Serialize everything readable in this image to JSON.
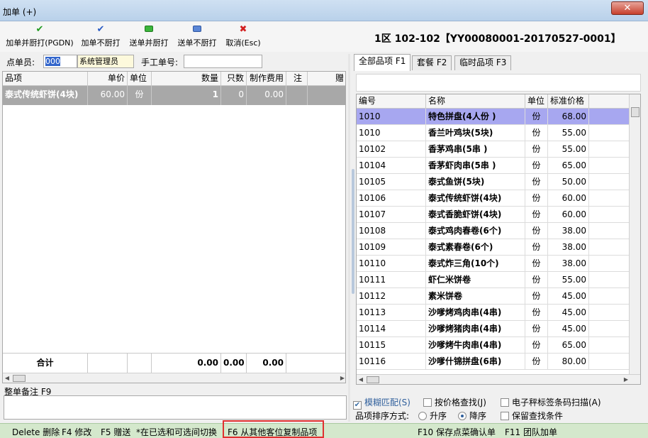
{
  "window": {
    "title": "加单 (+)",
    "close_label": "✕"
  },
  "toolbar": {
    "buttons": [
      {
        "label": "加单并厨打(PGDN)",
        "icon": "check-green-icon",
        "color": "#1f9a1f"
      },
      {
        "label": "加单不厨打",
        "icon": "check-blue-icon",
        "color": "#2a5bc4"
      },
      {
        "label": "送单并厨打",
        "icon": "green-square-icon",
        "color": "#3bb53b"
      },
      {
        "label": "送单不厨打",
        "icon": "blue-square-icon",
        "color": "#5a86d6"
      },
      {
        "label": "取消(Esc)",
        "icon": "cross-red-icon",
        "color": "#d22020"
      }
    ]
  },
  "header": {
    "title": "1区 102-102【YY00080001-20170527-0001】"
  },
  "order": {
    "waiter_label": "点单员:",
    "waiter_code": "000",
    "waiter_name": "系统管理员",
    "manual_no_label": "手工单号:",
    "manual_no_value": ""
  },
  "order_table": {
    "columns": [
      "品项",
      "单价",
      "单位",
      "数量",
      "只数",
      "制作费用",
      "注",
      "赠"
    ],
    "rows": [
      {
        "name": "泰式传统虾饼(4块)",
        "price": "60.00",
        "unit": "份",
        "qty": "1",
        "count": "0",
        "fee": "0.00"
      }
    ],
    "total": {
      "label": "合计",
      "qty": "0.00",
      "count": "0.00",
      "fee": "0.00"
    }
  },
  "remark": {
    "label": "整单备注 F9"
  },
  "tabs": [
    {
      "label": "全部品项 F1",
      "active": true
    },
    {
      "label": "套餐 F2",
      "active": false
    },
    {
      "label": "临时品项 F3",
      "active": false
    }
  ],
  "items_table": {
    "columns": [
      "编号",
      "名称",
      "单位",
      "标准价格"
    ],
    "rows": [
      {
        "code": "1010",
        "name": "特色拼盘(4人份 )",
        "unit": "份",
        "price": "68.00"
      },
      {
        "code": "1010",
        "name": "香兰叶鸡块(5块)",
        "unit": "份",
        "price": "55.00"
      },
      {
        "code": "10102",
        "name": "香茅鸡串(5串 )",
        "unit": "份",
        "price": "55.00"
      },
      {
        "code": "10104",
        "name": "香茅虾肉串(5串 )",
        "unit": "份",
        "price": "65.00"
      },
      {
        "code": "10105",
        "name": "泰式鱼饼(5块)",
        "unit": "份",
        "price": "50.00"
      },
      {
        "code": "10106",
        "name": "泰式传统虾饼(4块)",
        "unit": "份",
        "price": "60.00"
      },
      {
        "code": "10107",
        "name": "泰式香脆虾饼(4块)",
        "unit": "份",
        "price": "60.00"
      },
      {
        "code": "10108",
        "name": "泰式鸡肉春卷(6个)",
        "unit": "份",
        "price": "38.00"
      },
      {
        "code": "10109",
        "name": "泰式素春卷(6个)",
        "unit": "份",
        "price": "38.00"
      },
      {
        "code": "10110",
        "name": "泰式炸三角(10个)",
        "unit": "份",
        "price": "38.00"
      },
      {
        "code": "10111",
        "name": "虾仁米饼卷",
        "unit": "份",
        "price": "55.00"
      },
      {
        "code": "10112",
        "name": "素米饼卷",
        "unit": "份",
        "price": "45.00"
      },
      {
        "code": "10113",
        "name": "沙嗲烤鸡肉串(4串)",
        "unit": "份",
        "price": "45.00"
      },
      {
        "code": "10114",
        "name": "沙嗲烤猪肉串(4串)",
        "unit": "份",
        "price": "45.00"
      },
      {
        "code": "10115",
        "name": "沙嗲烤牛肉串(4串)",
        "unit": "份",
        "price": "65.00"
      },
      {
        "code": "10116",
        "name": "沙嗲什锦拼盘(6串)",
        "unit": "份",
        "price": "80.00"
      }
    ]
  },
  "options": {
    "fuzzy": "模糊匹配(S)",
    "by_price": "按价格查找(J)",
    "barcode": "电子秤标签条码扫描(A)",
    "sort_label": "品项排序方式:",
    "asc": "升序",
    "desc": "降序",
    "keep": "保留查找条件"
  },
  "status": {
    "s1": "Delete 删除",
    "s2": "F4 修改",
    "s3": "F5 赠送",
    "s4": "*在已选和可选间切换",
    "s5": "F6 从其他客位复制品项",
    "s6": "F10 保存点菜确认单",
    "s7": "F11 团队加单",
    "highlight_color": "#e03030"
  }
}
